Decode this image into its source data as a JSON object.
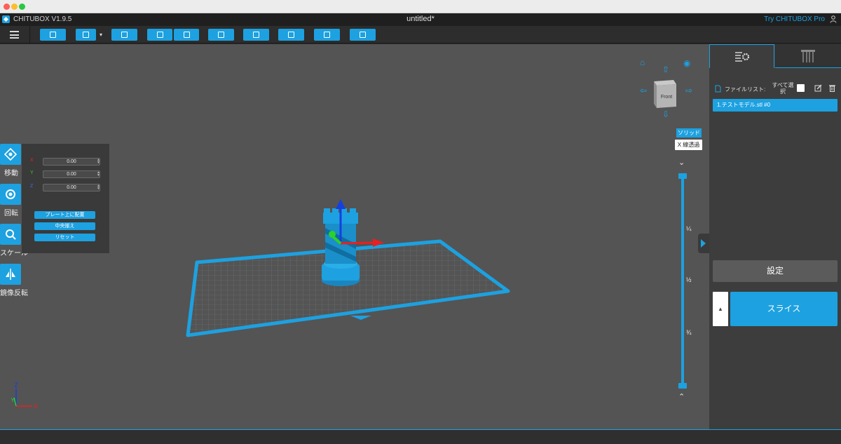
{
  "app": {
    "name": "CHITUBOX V1.9.5",
    "document_title": "untitled*",
    "pro_link": "Try CHITUBOX Pro"
  },
  "toolbar": {
    "buttons": [
      "open-file",
      "save",
      "select-all",
      "undo",
      "redo",
      "copy",
      "layout",
      "support",
      "hollow",
      "drill"
    ]
  },
  "tools": {
    "move": "移動",
    "rotate": "回転",
    "scale": "スケール",
    "mirror": "鏡像反転"
  },
  "move_panel": {
    "x_label": "X",
    "y_label": "Y",
    "z_label": "Z",
    "x_value": "0.00",
    "y_value": "0.00",
    "z_value": "0.00",
    "place_on_plate": "プレート上に配置",
    "center": "中央揃え",
    "reset": "リセット"
  },
  "view_cube": {
    "face_label": "Front"
  },
  "render_mode": {
    "solid": "ソリッド",
    "xray": "X 線透過"
  },
  "layer_slider": {
    "marks": [
      "¼",
      "½",
      "¾"
    ]
  },
  "axes": {
    "x": "X",
    "y": "Y",
    "z": "Z"
  },
  "right_panel": {
    "file_list_label": "ファイルリスト:",
    "select_all_label": "すべて選択",
    "files": [
      "1.テストモデル.stl #0"
    ],
    "settings_button": "設定",
    "slice_button": "スライス",
    "slice_arrow": "▲"
  },
  "colors": {
    "accent": "#1da1e0",
    "viewport_bg": "#545454",
    "panel_bg": "#3d3d3d",
    "x_axis": "#e82020",
    "y_axis": "#2bd12b",
    "z_axis": "#1440e0"
  }
}
